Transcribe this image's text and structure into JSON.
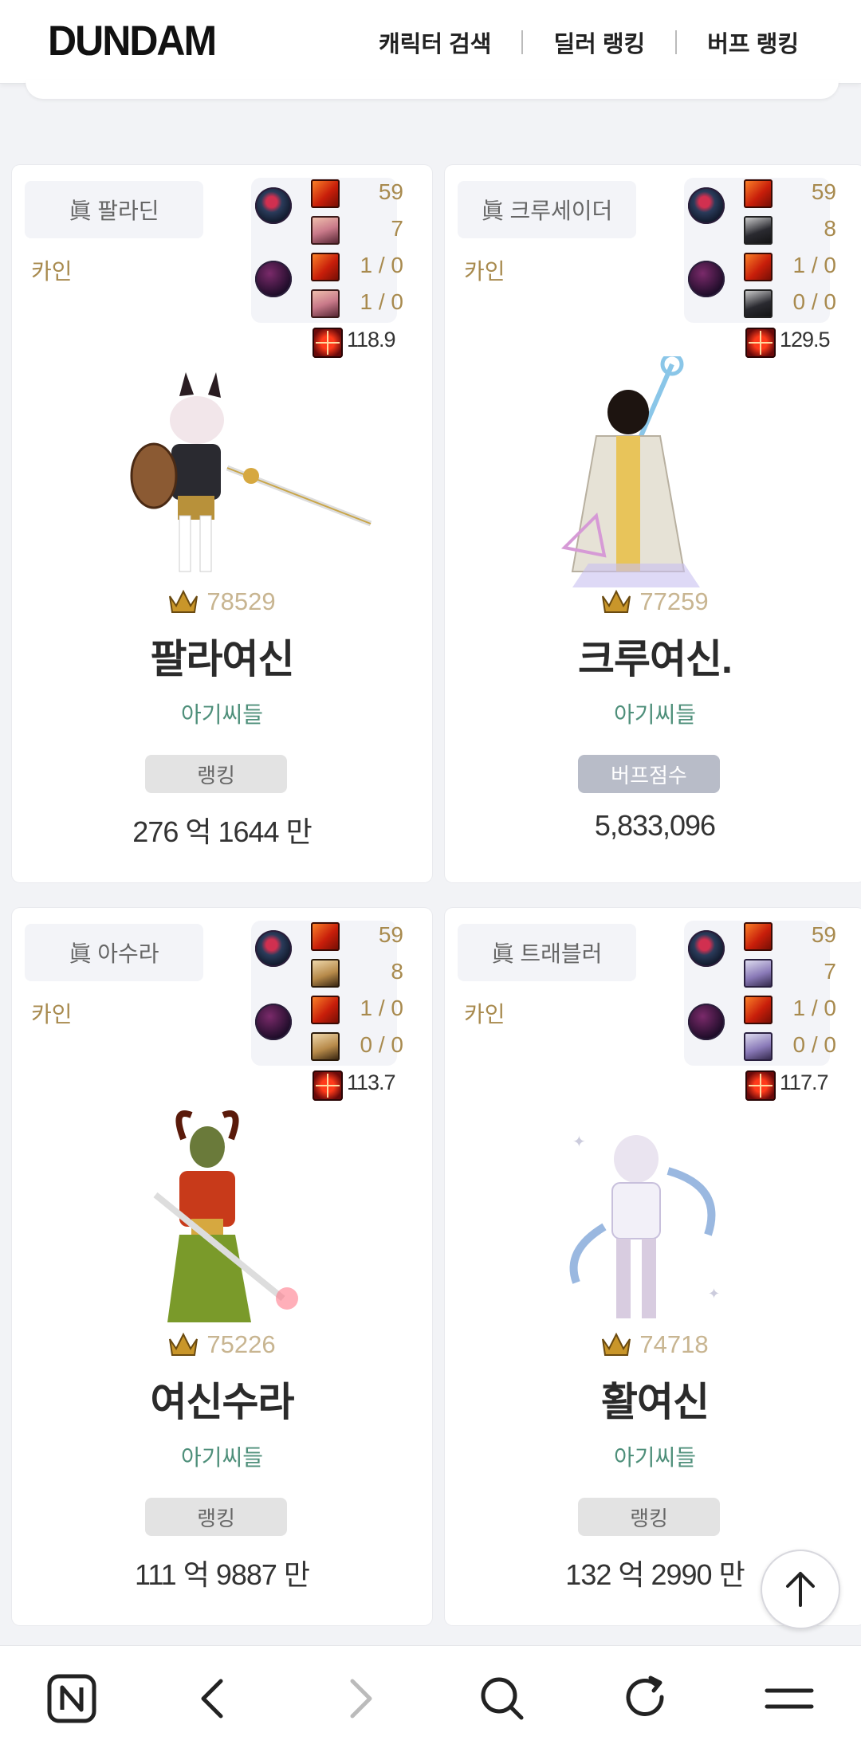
{
  "header": {
    "logo": "DUNDAM",
    "nav": [
      "캐릭터 검색",
      "딜러 랭킹",
      "버프 랭킹"
    ]
  },
  "cards": [
    {
      "class_name": "眞 팔라딘",
      "server": "카인",
      "equip": [
        "59",
        "7",
        "1 / 0",
        "1 / 0"
      ],
      "crest": "118.9",
      "fame": "78529",
      "name": "팔라여신",
      "guild": "아기씨들",
      "stat_label": "랭킹",
      "stat_value": "276 억 1644 만"
    },
    {
      "class_name": "眞 크루세이더",
      "server": "카인",
      "equip": [
        "59",
        "8",
        "1 / 0",
        "0 / 0"
      ],
      "crest": "129.5",
      "fame": "77259",
      "name": "크루여신.",
      "guild": "아기씨들",
      "stat_label": "버프점수",
      "stat_value": "5,833,096"
    },
    {
      "class_name": "眞 아수라",
      "server": "카인",
      "equip": [
        "59",
        "8",
        "1 / 0",
        "0 / 0"
      ],
      "crest": "113.7",
      "fame": "75226",
      "name": "여신수라",
      "guild": "아기씨들",
      "stat_label": "랭킹",
      "stat_value": "111 억 9887 만"
    },
    {
      "class_name": "眞 트래블러",
      "server": "카인",
      "equip": [
        "59",
        "7",
        "1 / 0",
        "0 / 0"
      ],
      "crest": "117.7",
      "fame": "74718",
      "name": "활여신",
      "guild": "아기씨들",
      "stat_label": "랭킹",
      "stat_value": "132 억 2990 만"
    }
  ],
  "bottom_bar": [
    "n-home-icon",
    "back-icon",
    "forward-icon",
    "search-icon",
    "refresh-icon",
    "menu-icon"
  ]
}
